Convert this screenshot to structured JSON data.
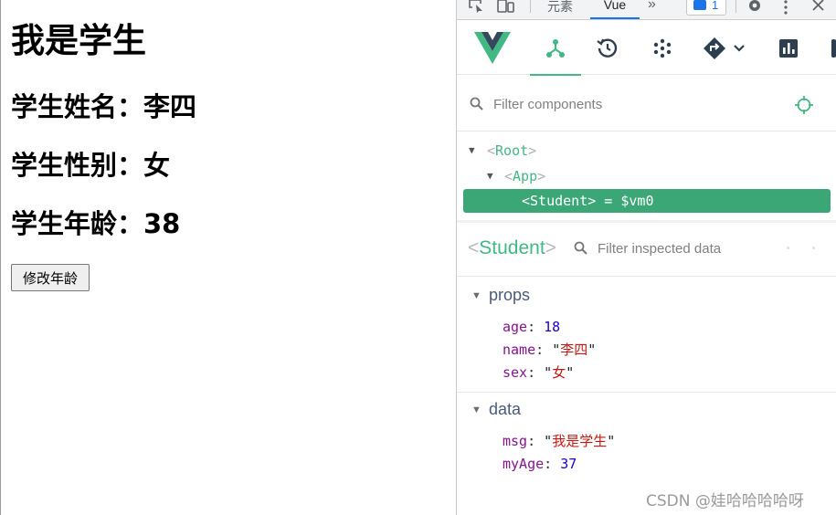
{
  "app": {
    "heading": "我是学生",
    "name_line": "学生姓名：李四",
    "sex_line": "学生性别：女",
    "age_line": "学生年龄：38",
    "change_age_button": "修改年龄"
  },
  "devtools": {
    "tabs": {
      "elements": "元素",
      "vue": "Vue"
    },
    "issues_count": "1",
    "toolbar": {
      "icons": [
        "vue-logo-icon",
        "components-tree-icon",
        "timeline-icon",
        "plugins-icon",
        "routing-icon",
        "performance-icon"
      ],
      "active": "components",
      "accent": "#42b883"
    },
    "component_filter": {
      "placeholder": "Filter components"
    },
    "tree": {
      "root": {
        "lt": "<",
        "name": "Root",
        "gt": ">"
      },
      "app": {
        "lt": "<",
        "name": "App",
        "gt": ">"
      },
      "student": {
        "lt": "<",
        "name": "Student",
        "gt": ">",
        "suffix": " = $vm0"
      },
      "selected_color": "#3ba776"
    },
    "inspector": {
      "lt": "<",
      "name": "Student",
      "gt": ">",
      "filter_placeholder": "Filter inspected data",
      "props": {
        "title": "props",
        "age": {
          "key": "age",
          "value": "18"
        },
        "name": {
          "key": "name",
          "value": "李四"
        },
        "sex": {
          "key": "sex",
          "value": "女"
        }
      },
      "data": {
        "title": "data",
        "msg": {
          "key": "msg",
          "value": "我是学生"
        },
        "myAge": {
          "key": "myAge",
          "value": "37"
        }
      }
    }
  },
  "watermark": "CSDN @娃哈哈哈哈呀"
}
